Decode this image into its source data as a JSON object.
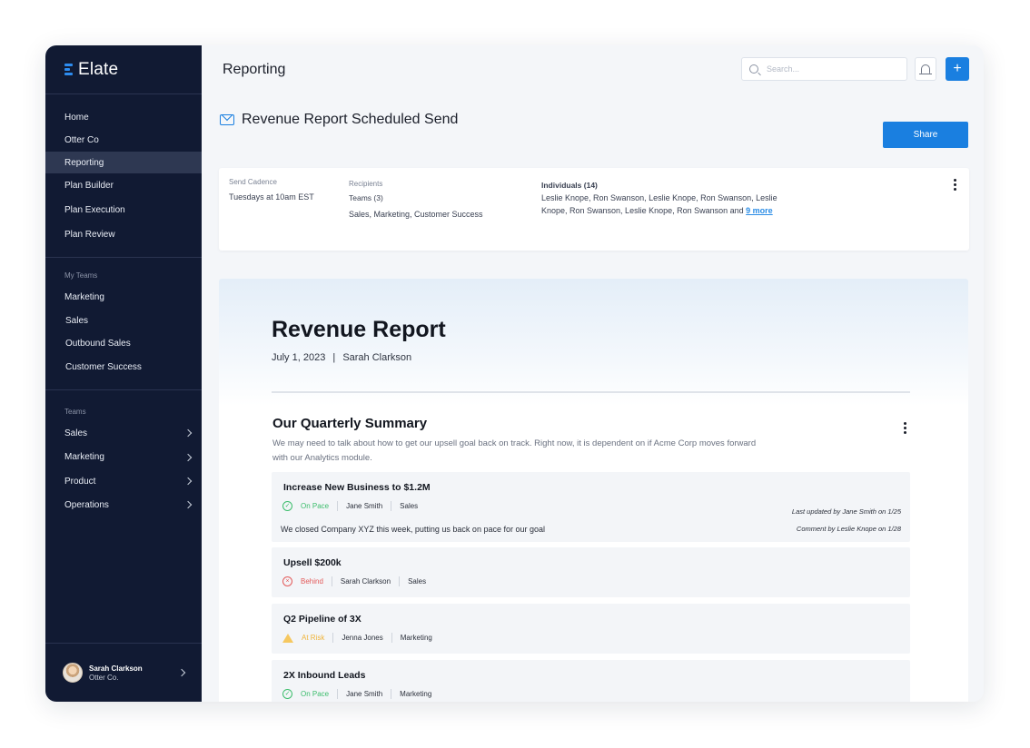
{
  "app": {
    "name": "Elate"
  },
  "sidebar": {
    "primary": [
      "Home",
      "Otter Co",
      "Reporting",
      "Plan Builder",
      "Plan Execution",
      "Plan Review"
    ],
    "my_teams_heading": "My Teams",
    "my_teams": [
      "Marketing",
      "Sales",
      "Outbound Sales",
      "Customer Success"
    ],
    "teams_heading": "Teams",
    "teams": [
      "Sales",
      "Marketing",
      "Product",
      "Operations"
    ],
    "user": {
      "name": "Sarah Clarkson",
      "org": "Otter Co."
    }
  },
  "header": {
    "title": "Reporting",
    "search_placeholder": "Search...",
    "add_label": "+"
  },
  "schedule": {
    "title": "Revenue Report Scheduled Send",
    "share_label": "Share",
    "cadence_label": "Send Cadence",
    "cadence_value": "Tuesdays at 10am EST",
    "recipients_label": "Recipients",
    "teams_label": "Teams (3)",
    "teams_value": "Sales, Marketing, Customer Success",
    "individuals_label": "Individuals (14)",
    "individuals_line1": "Leslie Knope, Ron Swanson, Leslie Knope, Ron Swanson, Leslie",
    "individuals_line2": "Knope, Ron Swanson, Leslie Knope, Ron Swanson and",
    "more_link": "9 more"
  },
  "report": {
    "title": "Revenue Report",
    "date": "July 1, 2023",
    "separator": "|",
    "author": "Sarah Clarkson",
    "summary_title": "Our Quarterly Summary",
    "summary_desc": "We may need to talk about how to get our upsell goal back on track. Right now, it is dependent on if Acme Corp moves forward with our Analytics module.",
    "goals": [
      {
        "title": "Increase New Business to $1.2M",
        "status": "On Pace",
        "owner": "Jane Smith",
        "team": "Sales",
        "comment": "We closed Company XYZ this week, putting us back on pace for our goal",
        "updated": "Last updated by Jane Smith on 1/25",
        "comment_by": "Comment by Leslie Knope on 1/28"
      },
      {
        "title": "Upsell $200k",
        "status": "Behind",
        "owner": "Sarah Clarkson",
        "team": "Sales"
      },
      {
        "title": "Q2 Pipeline of 3X",
        "status": "At Risk",
        "owner": "Jenna Jones",
        "team": "Marketing"
      },
      {
        "title": "2X Inbound Leads",
        "status": "On Pace",
        "owner": "Jane Smith",
        "team": "Marketing"
      }
    ]
  },
  "colors": {
    "accent": "#1a7fe0",
    "sidebar": "#111a33",
    "on_pace": "#3bbd6b",
    "behind": "#e35a5a",
    "at_risk": "#f0b43a"
  },
  "icons": [
    "search-icon",
    "bell-icon",
    "plus-icon",
    "mail-icon",
    "kebab-icon",
    "chevron-right-icon",
    "check-circle-icon",
    "x-circle-icon",
    "warning-icon"
  ]
}
